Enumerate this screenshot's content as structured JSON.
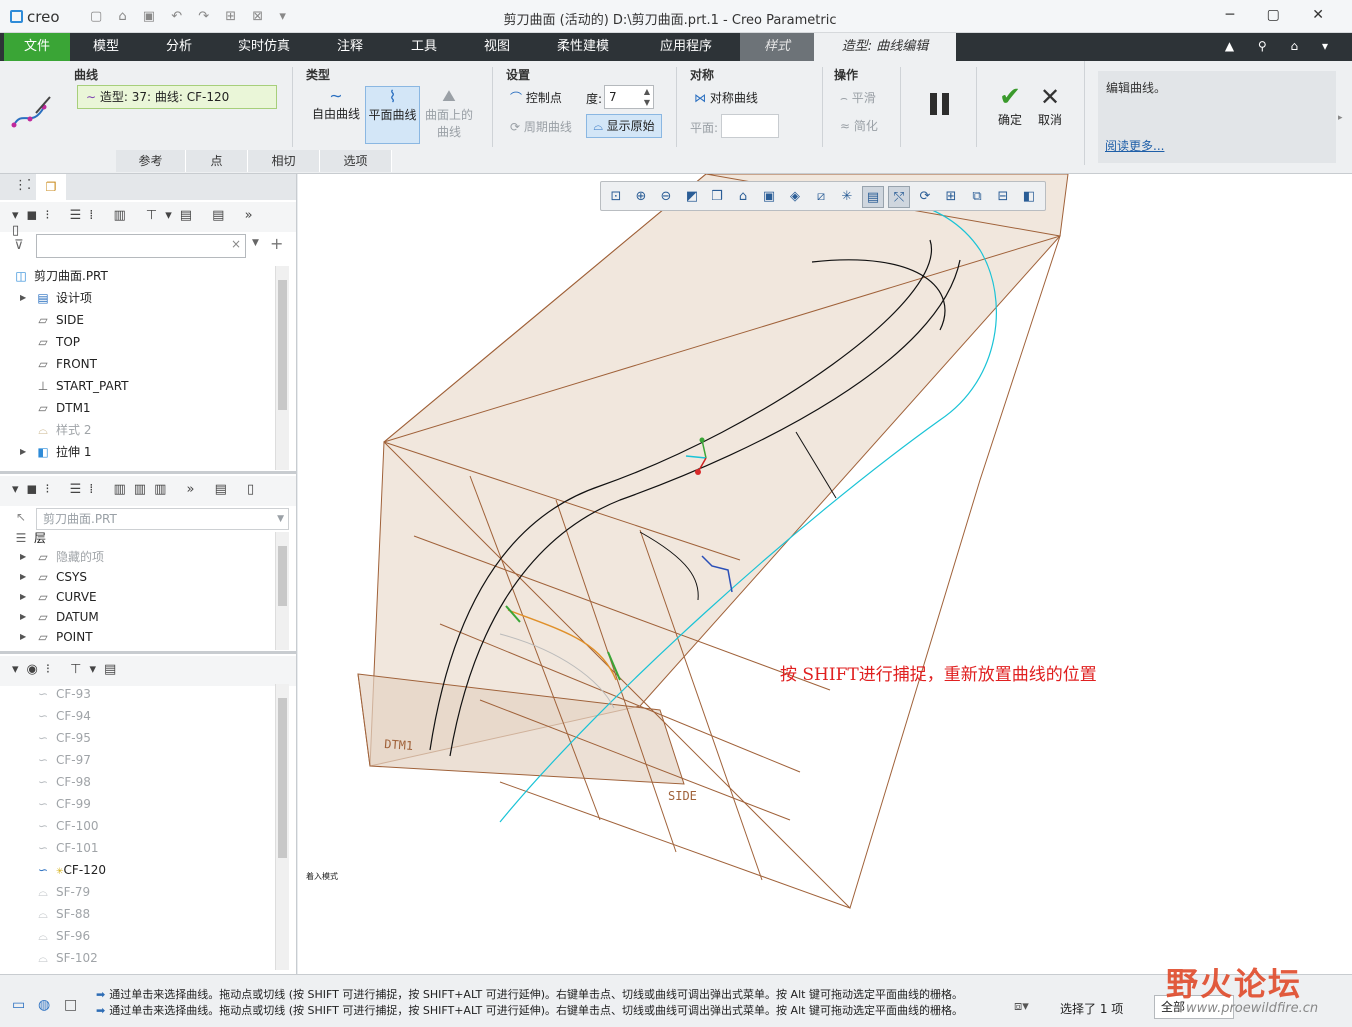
{
  "titlebar": {
    "logo": "creo",
    "title": "剪刀曲面 (活动的) D:\\剪刀曲面.prt.1 - Creo Parametric",
    "qat": "▢ ⌂ ▣ ↶ ↷ ⊞ ⊠ ▾",
    "window_buttons": "─ ▢ ✕"
  },
  "menu_tabs": [
    {
      "label": "文件"
    },
    {
      "label": "模型"
    },
    {
      "label": "分析"
    },
    {
      "label": "实时仿真"
    },
    {
      "label": "注释"
    },
    {
      "label": "工具"
    },
    {
      "label": "视图"
    },
    {
      "label": "柔性建模"
    },
    {
      "label": "应用程序"
    },
    {
      "label": "样式"
    },
    {
      "label": "造型: 曲线编辑"
    }
  ],
  "tabbar_icons": "▲ ⚲ ⌂ ▾",
  "ribbon": {
    "curve_group": {
      "title": "曲线",
      "field": "造型: 37: 曲线: CF-120"
    },
    "type_group": {
      "title": "类型",
      "free": "自由曲线",
      "planar": "平面曲线",
      "on_surface_1": "曲面上的",
      "on_surface_2": "曲线"
    },
    "settings_group": {
      "title": "设置",
      "control_point": "控制点",
      "degree_label": "度:",
      "degree_value": "7",
      "periodic": "周期曲线",
      "show_original": "显示原始"
    },
    "symmetry_group": {
      "title": "对称",
      "sym_curve": "对称曲线",
      "plane_label": "平面:"
    },
    "ops_group": {
      "title": "操作",
      "smooth": "平滑",
      "simplify": "简化"
    },
    "ok": "确定",
    "cancel": "取消",
    "help_text": "编辑曲线。",
    "help_link": "阅读更多...",
    "subtabs": [
      "参考",
      "点",
      "相切",
      "选项"
    ]
  },
  "model_tree": {
    "root": "剪刀曲面.PRT",
    "items": [
      {
        "label": "设计项",
        "dim": false
      },
      {
        "label": "SIDE",
        "dim": false
      },
      {
        "label": "TOP",
        "dim": false
      },
      {
        "label": "FRONT",
        "dim": false
      },
      {
        "label": "START_PART",
        "dim": false
      },
      {
        "label": "DTM1",
        "dim": false
      },
      {
        "label": "样式 2",
        "dim": true
      },
      {
        "label": "拉伸 1",
        "dim": false
      }
    ]
  },
  "layer_tree": {
    "combo": "剪刀曲面.PRT",
    "header": "层",
    "items": [
      "隐藏的项",
      "CSYS",
      "CURVE",
      "DATUM",
      "POINT"
    ]
  },
  "style_tree": {
    "items": [
      {
        "label": "CF-93",
        "active": false
      },
      {
        "label": "CF-94",
        "active": false
      },
      {
        "label": "CF-95",
        "active": false
      },
      {
        "label": "CF-97",
        "active": false
      },
      {
        "label": "CF-98",
        "active": false
      },
      {
        "label": "CF-99",
        "active": false
      },
      {
        "label": "CF-100",
        "active": false
      },
      {
        "label": "CF-101",
        "active": false
      },
      {
        "label": "CF-120",
        "active": true
      },
      {
        "label": "SF-79",
        "active": false
      },
      {
        "label": "SF-88",
        "active": false
      },
      {
        "label": "SF-96",
        "active": false
      },
      {
        "label": "SF-102",
        "active": false
      }
    ]
  },
  "graphics": {
    "annotation": "按 SHIFT进行捕捉，重新放置曲线的位置",
    "annotation_color": "#e02020",
    "label_dtm1": "DTM1",
    "label_side": "SIDE",
    "mode_text": "着入模式"
  },
  "status": {
    "msg1": "通过单击来选择曲线。拖动点或切线 (按 SHIFT 可进行捕捉，按 SHIFT+ALT 可进行延伸)。右键单击点、切线或曲线可调出弹出式菜单。按 Alt 键可拖动选定平面曲线的栅格。",
    "msg2": "通过单击来选择曲线。拖动点或切线 (按 SHIFT 可进行捕捉，按 SHIFT+ALT 可进行延伸)。右键单击点、切线或曲线可调出弹出式菜单。按 Alt 键可拖动选定平面曲线的栅格。",
    "selected": "选择了 1 项",
    "filter": "全部"
  },
  "watermark": {
    "title": "野火论坛",
    "url": "www.proewildfire.cn"
  },
  "colors": {
    "accent_green": "#3aa536",
    "tabbar": "#2d3337",
    "curve_cyan": "#19c3d6",
    "grid_brown": "#a0623a"
  }
}
